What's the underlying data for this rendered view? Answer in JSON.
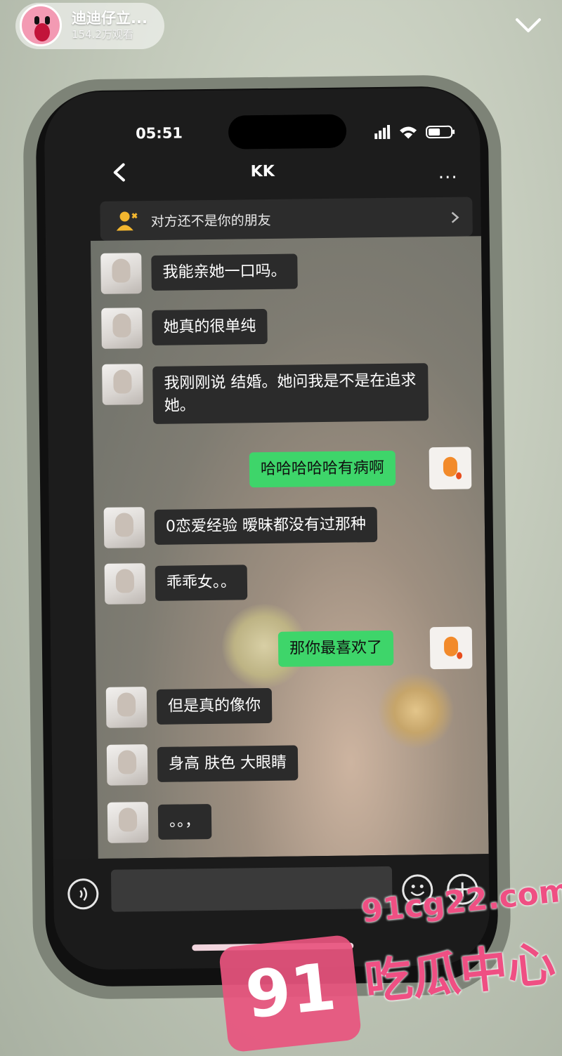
{
  "overlay": {
    "username": "迪迪仔立...",
    "view_count": "154.2万观看"
  },
  "status_bar": {
    "time": "05:51"
  },
  "chat_header": {
    "title": "KK",
    "more": "..."
  },
  "notice": {
    "text": "对方还不是你的朋友"
  },
  "messages": [
    {
      "from": "them",
      "text": "我能亲她一口吗。"
    },
    {
      "from": "them",
      "text": "她真的很单纯"
    },
    {
      "from": "them",
      "text": "我刚刚说 结婚。她问我是不是在追求她。"
    },
    {
      "from": "me",
      "text": "哈哈哈哈哈有病啊"
    },
    {
      "from": "them",
      "text": "0恋爱经验 暧昧都没有过那种"
    },
    {
      "from": "them",
      "text": "乖乖女。。"
    },
    {
      "from": "me",
      "text": "那你最喜欢了"
    },
    {
      "from": "them",
      "text": "但是真的像你"
    },
    {
      "from": "them",
      "text": "身高 肤色 大眼睛"
    },
    {
      "from": "them",
      "text": "。。，"
    }
  ],
  "watermark": {
    "badge": "91",
    "domain": "91cg22.com",
    "name": "吃瓜中心"
  },
  "colors": {
    "my_bubble": "#3ed56a",
    "their_bubble": "#2b2b2b",
    "watermark": "#ef4f83"
  }
}
